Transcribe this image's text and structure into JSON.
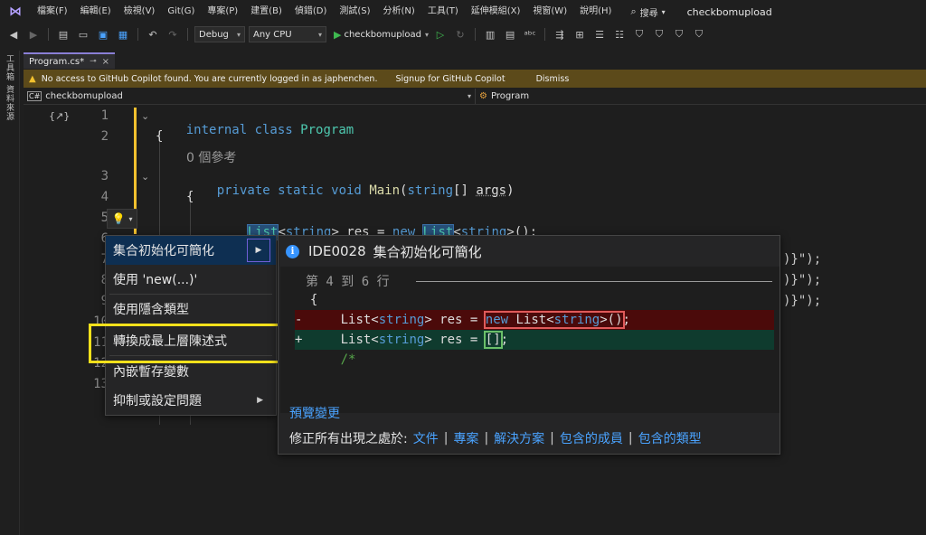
{
  "menubar": {
    "items": [
      "檔案(F)",
      "編輯(E)",
      "檢視(V)",
      "Git(G)",
      "專案(P)",
      "建置(B)",
      "偵錯(D)",
      "測試(S)",
      "分析(N)",
      "工具(T)",
      "延伸模組(X)",
      "視窗(W)",
      "說明(H)"
    ],
    "search_label": "搜尋",
    "solution_title": "checkbomupload"
  },
  "toolbar": {
    "config": "Debug",
    "platform": "Any CPU",
    "run_target": "checkbomupload"
  },
  "left_strip": {
    "tabs": [
      "工具箱",
      "資料來源"
    ]
  },
  "doc_tab": {
    "label": "Program.cs*",
    "pin_glyph": "⊸",
    "close_glyph": "×"
  },
  "infobar": {
    "message": "No access to GitHub Copilot found. You are currently logged in as japhenchen.",
    "signup": "Signup for GitHub Copilot",
    "dismiss": "Dismiss"
  },
  "navbar": {
    "project": "checkbomupload",
    "member": "Program"
  },
  "editor": {
    "line_numbers": [
      "1",
      "2",
      "3",
      "4",
      "5",
      "6",
      "7",
      "8",
      "9",
      "10",
      "11",
      "12",
      "13"
    ],
    "code": {
      "l1_kw": "internal class",
      "l1_name": "Program",
      "l2": "{",
      "refs": "0 個參考",
      "l3_kw": "private static void",
      "l3_fn": "Main",
      "l3_paren_open": "(",
      "l3_type": "string",
      "l3_rest": "[] ",
      "l3_arg": "args",
      "l3_close": ")",
      "l4": "{",
      "l5_list": "List",
      "l5_lt": "<",
      "l5_string": "string",
      "l5_gt_res": "> res = ",
      "l5_new": "new",
      "l5_space": " ",
      "l5_list2": "List",
      "l5_lt2": "<",
      "l5_string2": "string",
      "l5_end": ">();",
      "tail1": ")}\");",
      "tail2": ")}\");",
      "tail3": ")}\");"
    }
  },
  "quick_actions": {
    "items": [
      {
        "label": "集合初始化可簡化",
        "has_submenu": true
      },
      {
        "label": "使用 'new(...)'",
        "has_submenu": false
      },
      {
        "label": "使用隱含類型",
        "has_submenu": false
      },
      {
        "label": "轉換成最上層陳述式",
        "has_submenu": false
      },
      {
        "label": "內嵌暫存變數",
        "has_submenu": false
      },
      {
        "label": "抑制或設定問題",
        "has_submenu": true
      }
    ],
    "highlighted_index": 3
  },
  "preview": {
    "diagnostic_id": "IDE0028",
    "title": "集合初始化可簡化",
    "range_label": "第 4 到 6 行",
    "open_brace": "{",
    "removed_sign": "-",
    "removed_prefix": "List<",
    "removed_type": "string",
    "removed_mid": "> res = ",
    "removed_new": "new",
    "removed_list": " List<",
    "removed_type2": "string",
    "removed_end": ">()",
    "removed_semi": ";",
    "added_sign": "+",
    "added_prefix": "List<",
    "added_type": "string",
    "added_mid": "> res = ",
    "added_value": "[]",
    "added_semi": ";",
    "comment": "/*",
    "preview_changes": "預覽變更",
    "fix_all_label": "修正所有出現之處於:",
    "fix_all_scopes": [
      "文件",
      "專案",
      "解決方案",
      "包含的成員",
      "包含的類型"
    ]
  },
  "colors": {
    "accent": "#8a7fd6",
    "infobar_bg": "#5c4a1a",
    "link": "#4aa3ff",
    "highlight_box": "#f5e11b",
    "removed_bg": "#4b0a0a",
    "added_bg": "#0f3b2e"
  }
}
